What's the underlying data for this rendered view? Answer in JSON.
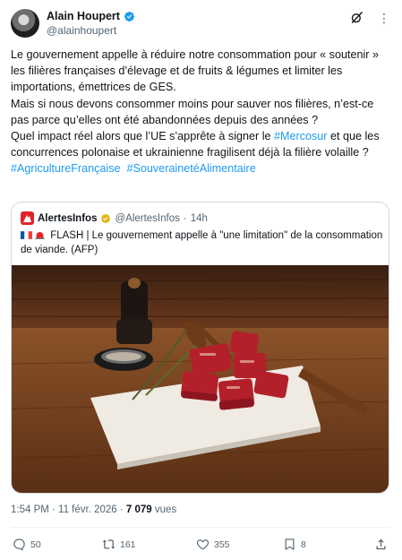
{
  "author": {
    "name": "Alain Houpert",
    "handle": "@alainhoupert"
  },
  "tweet": {
    "p1": "Le gouvernement appelle à réduire notre consommation pour « soutenir » les filières françaises d’élevage et de fruits & légumes et limiter les importations, émettrices de GES.",
    "p2": "Mais si nous devons consommer moins pour sauver nos filières, n’est-ce pas parce qu’elles ont été abandonnées depuis des années ?",
    "p3_before": "Quel impact réel alors que l’UE s’apprête à signer le ",
    "p3_hashtag": "#Mercosur",
    "p3_after": " et que les concurrences polonaise et ukrainienne fragilisent déjà la filière volaille ?",
    "hashtag1": "#AgricultureFrançaise",
    "hashtag2": "#SouverainetéAlimentaire"
  },
  "quote": {
    "name": "AlertesInfos",
    "handle": "@AlertesInfos",
    "separator": "·",
    "time": "14h",
    "text": "FLASH | Le gouvernement appelle à \"une limitation\" de la consommation de viande. (AFP)"
  },
  "meta": {
    "time_date": "1:54 PM · 11 févr. 2026 · ",
    "views_count": "7 079",
    "views_label": " vues"
  },
  "actions": {
    "replies": "50",
    "reposts": "161",
    "likes": "355",
    "bookmarks": "8"
  },
  "colors": {
    "link": "#1d9bf0",
    "secondary_text": "#536471",
    "border": "#cfd9de",
    "verified_blue": "#1d9bf0",
    "verified_gold": "#e2b719",
    "alertes_red": "#e0242a"
  },
  "icons": [
    "verified-badge-icon",
    "grok-icon",
    "more-icon",
    "alertesinfos-logo",
    "gold-verified-icon",
    "france-flag-icon",
    "siren-icon",
    "reply-icon",
    "repost-icon",
    "like-icon",
    "bookmark-icon",
    "share-icon"
  ]
}
